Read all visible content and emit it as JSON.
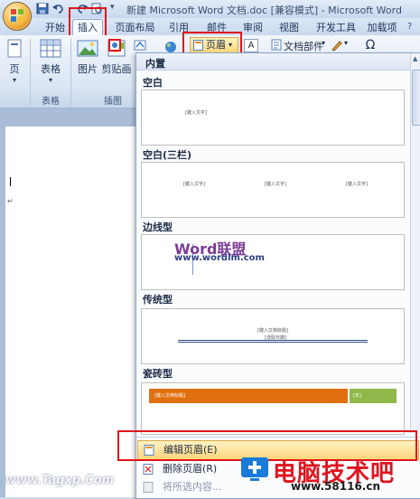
{
  "title_bar": {
    "title": "新建 Microsoft Word 文档.doc [兼容模式] - Microsoft Word"
  },
  "tabs": [
    "开始",
    "插入",
    "页面布局",
    "引用",
    "邮件",
    "审阅",
    "视图",
    "开发工具",
    "加载项"
  ],
  "active_tab": "插入",
  "ribbon": {
    "page_btn": "页",
    "table_btn": "表格",
    "picture_btn": "图片",
    "clipart_btn": "剪贴画",
    "header_btn": "页眉",
    "docparts_btn": "文档部件",
    "groups": {
      "table": "表格",
      "illustrations": "插图"
    }
  },
  "gallery": {
    "header": "内置",
    "sections": [
      {
        "title": "空白",
        "placeholders": [
          "[键入文字]"
        ]
      },
      {
        "title": "空白(三栏)",
        "placeholders": [
          "[键入文字]",
          "[键入文字]",
          "[键入文字]"
        ]
      },
      {
        "title": "边线型",
        "brand": "Word联盟",
        "url": "www.wordlm.com"
      },
      {
        "title": "传统型",
        "placeholders": [
          "[键入文档标题]",
          "[选取日期]"
        ]
      },
      {
        "title": "瓷砖型",
        "placeholders": [
          "[键入文档标题]",
          "[年]"
        ]
      }
    ]
  },
  "menu": {
    "edit_header": "编辑页眉(E)",
    "remove_header": "删除页眉(R)",
    "save_selection": "将所选内容..."
  },
  "watermarks": {
    "left": "www.Tagxp.Com",
    "right_text": "电脑技术吧",
    "right_url": "www.58116.cn"
  },
  "colors": {
    "red_highlight": "#e0161b",
    "tile_orange": "#e0700f",
    "tile_green": "#8fb94b",
    "hover_yellow": "#fbd57a"
  }
}
